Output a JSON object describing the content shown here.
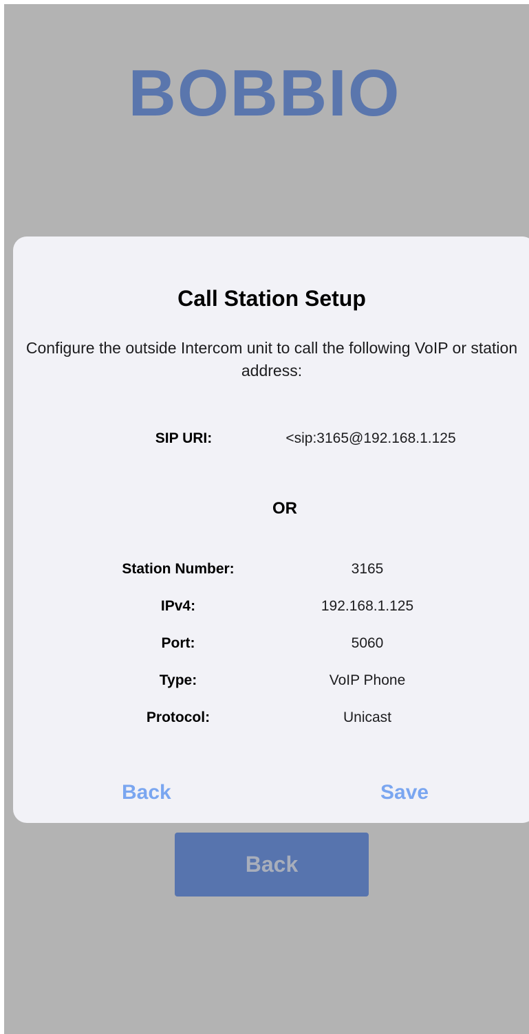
{
  "app": {
    "brand": "BOBBIO",
    "back_button_label": "Back"
  },
  "dialog": {
    "title": "Call Station Setup",
    "message": "Configure the outside Intercom unit to call the following VoIP or station address:",
    "sip_uri": {
      "label": "SIP URI:",
      "value": "<sip:3165@192.168.1.125"
    },
    "or_text": "OR",
    "fields": [
      {
        "label": "Station Number:",
        "value": "3165"
      },
      {
        "label": "IPv4:",
        "value": "192.168.1.125"
      },
      {
        "label": "Port:",
        "value": "5060"
      },
      {
        "label": "Type:",
        "value": "VoIP Phone"
      },
      {
        "label": "Protocol:",
        "value": "Unicast"
      }
    ],
    "back_label": "Back",
    "save_label": "Save"
  },
  "colors": {
    "background": "#b3b3b3",
    "brand": "#5a76ad",
    "dialog_bg": "#f2f2f7",
    "dialog_button": "#7aa6f0",
    "back_button_bg": "#5774ae"
  }
}
